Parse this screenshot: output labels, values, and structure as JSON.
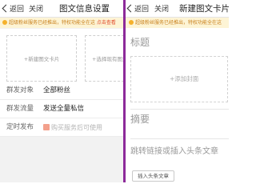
{
  "left": {
    "nav": {
      "back_label": "返回",
      "close_label": "关闭",
      "title": "图文信息设置"
    },
    "notice": {
      "text": "超级粉丝服务已经推出，特权功能全在这 ",
      "link": "点击查看"
    },
    "tiles": [
      {
        "label": "+新建图文卡片"
      },
      {
        "label": "+选择现有图文"
      }
    ],
    "rows": [
      {
        "label": "群发对象",
        "value": "全部粉丝"
      },
      {
        "label": "群发流量",
        "value": "发送全量私信"
      },
      {
        "label": "定时发布",
        "value": "购买服务后可使用"
      }
    ]
  },
  "right": {
    "nav": {
      "back_label": "返回",
      "close_label": "关闭",
      "title": "新建图文卡片"
    },
    "notice": {
      "text": "超级粉丝服务已经推出，特权功能全在这"
    },
    "title_placeholder": "标题",
    "cover_label": "+添加封面",
    "summary_placeholder": "摘要",
    "link_placeholder": "跳转链接或插入头条文章",
    "insert_button": "插入头条文章"
  }
}
